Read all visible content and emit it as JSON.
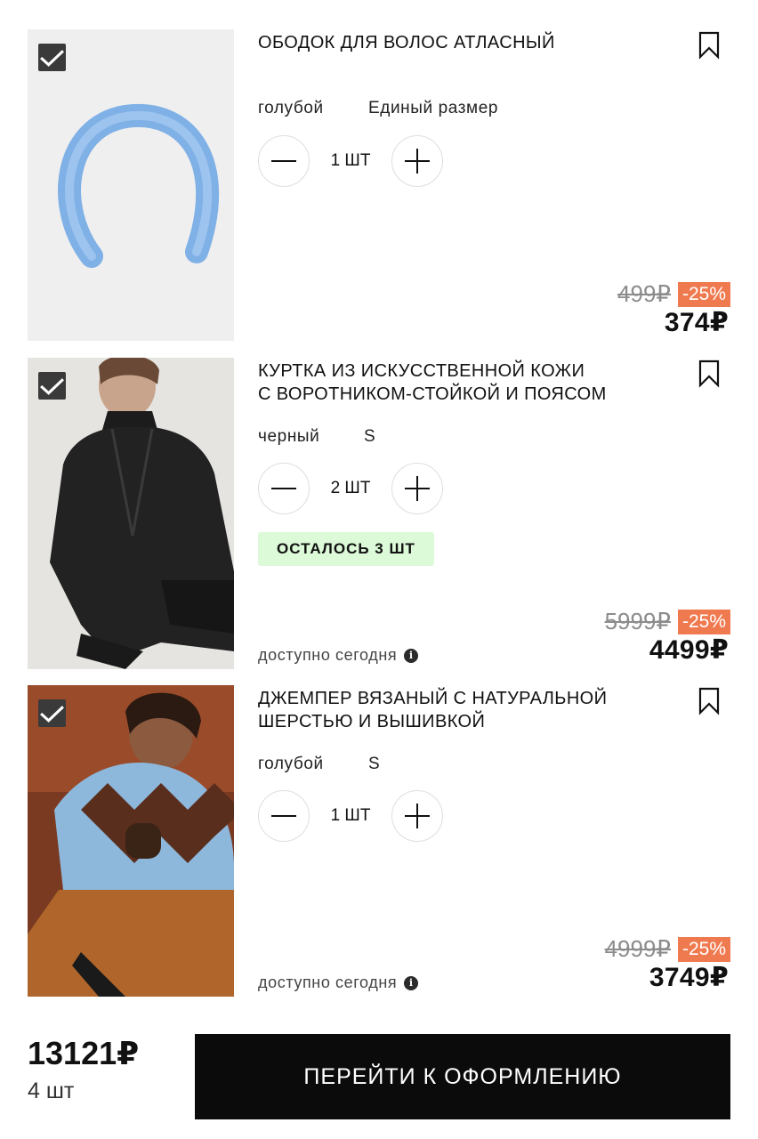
{
  "items": [
    {
      "title": "ОБОДОК ДЛЯ ВОЛОС АТЛАСНЫЙ",
      "color": "голубой",
      "size": "Единый размер",
      "quantity": "1 ШТ",
      "old_price": "499₽",
      "discount": "-25%",
      "price": "374₽"
    },
    {
      "title_line1": "КУРТКА ИЗ ИСКУССТВЕННОЙ КОЖИ",
      "title_line2": "С ВОРОТНИКОМ-СТОЙКОЙ И ПОЯСОМ",
      "color": "черный",
      "size": "S",
      "quantity": "2 ШТ",
      "stock_badge": "ОСТАЛОСЬ 3 ШТ",
      "availability": "доступно сегодня",
      "old_price": "5999₽",
      "discount": "-25%",
      "price": "4499₽"
    },
    {
      "title_line1": "ДЖЕМПЕР ВЯЗАНЫЙ С НАТУРАЛЬНОЙ",
      "title_line2": "ШЕРСТЬЮ И ВЫШИВКОЙ",
      "color": "голубой",
      "size": "S",
      "quantity": "1 ШТ",
      "availability": "доступно сегодня",
      "old_price": "4999₽",
      "discount": "-25%",
      "price": "3749₽"
    }
  ],
  "footer": {
    "total": "13121₽",
    "count": "4 шт",
    "checkout_label": "ПЕРЕЙТИ К ОФОРМЛЕНИЮ"
  },
  "colors": {
    "discount_badge": "#f07a50",
    "stock_badge_bg": "#dcf9d8",
    "checkout_bg": "#0b0b0b"
  },
  "icons": [
    "check-icon",
    "bookmark-icon",
    "minus-icon",
    "plus-icon",
    "info-icon"
  ]
}
